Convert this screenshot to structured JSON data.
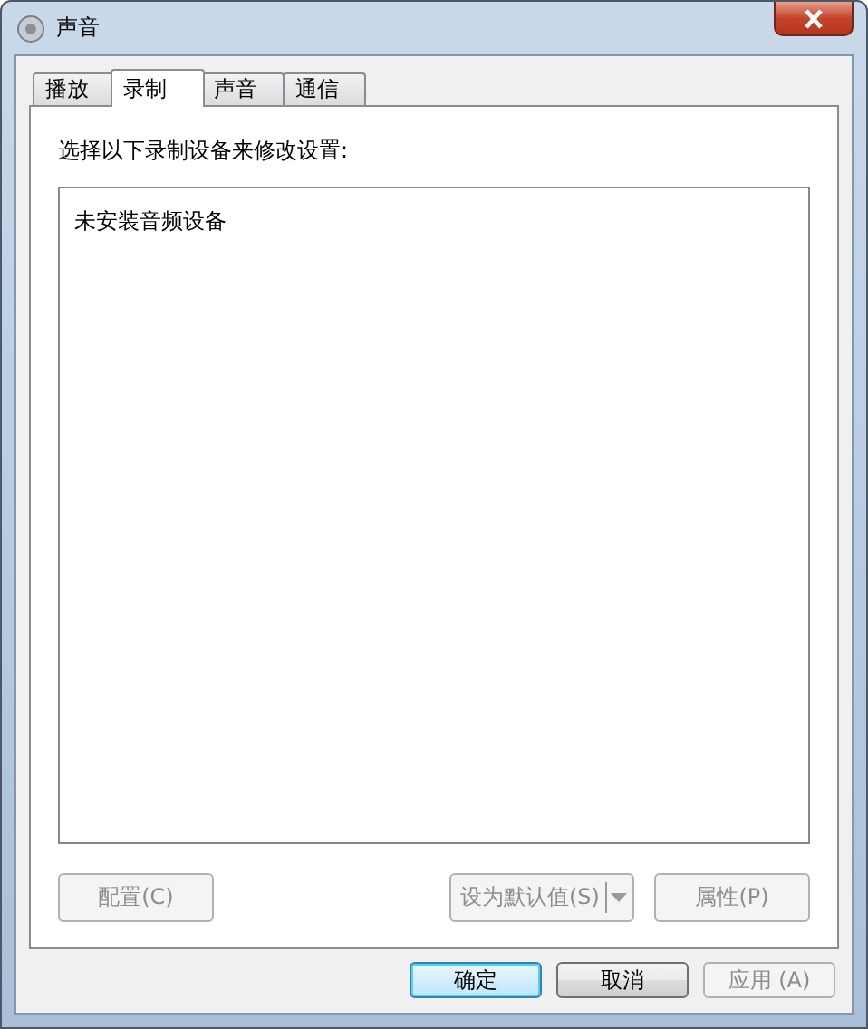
{
  "window": {
    "title": "声音"
  },
  "tabs": [
    {
      "label": "播放",
      "selected": false
    },
    {
      "label": "录制",
      "selected": true
    },
    {
      "label": "声音",
      "selected": false
    },
    {
      "label": "通信",
      "selected": false
    }
  ],
  "panel": {
    "prompt": "选择以下录制设备来修改设置:",
    "device_list": {
      "empty_message": "未安装音频设备"
    },
    "buttons": [
      {
        "label": "配置(C)",
        "disabled": true,
        "kind": "button"
      },
      {
        "label": "设为默认值(S)",
        "disabled": true,
        "kind": "split"
      },
      {
        "label": "属性(P)",
        "disabled": true,
        "kind": "button"
      }
    ]
  },
  "buttons": [
    {
      "label": "确定",
      "disabled": false,
      "default": true
    },
    {
      "label": "取消",
      "disabled": false,
      "default": false
    },
    {
      "label": "应用 (A)",
      "disabled": true,
      "default": false
    }
  ]
}
